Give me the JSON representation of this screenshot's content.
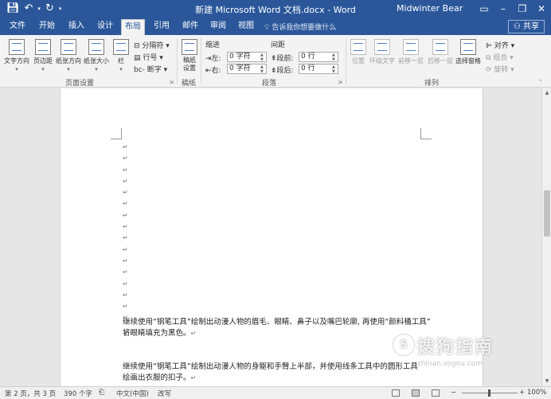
{
  "titlebar": {
    "title": "新建 Microsoft Word 文档.docx  -  Word",
    "user": "Midwinter Bear",
    "qat": {
      "save_icon": "save-icon",
      "undo_icon": "undo-icon",
      "redo_icon": "redo-icon"
    }
  },
  "tabs": [
    {
      "label": "文件"
    },
    {
      "label": "开始"
    },
    {
      "label": "插入"
    },
    {
      "label": "设计"
    },
    {
      "label": "布局"
    },
    {
      "label": "引用"
    },
    {
      "label": "邮件"
    },
    {
      "label": "审阅"
    },
    {
      "label": "视图"
    }
  ],
  "active_tab": "布局",
  "tell_me": "告诉我你想要做什么",
  "share": "共享",
  "ribbon": {
    "page_setup": {
      "label": "页面设置",
      "text_direction": "文字方向",
      "margins": "页边距",
      "orientation": "纸张方向",
      "size": "纸张大小",
      "columns": "栏",
      "breaks": "分隔符",
      "line_numbers": "行号",
      "hyphenation": "断字"
    },
    "draft": {
      "label": "稿纸",
      "button": "稿纸设置"
    },
    "paragraph": {
      "label": "段落",
      "indent": "缩进",
      "spacing": "间距",
      "left": "左:",
      "right": "右:",
      "before": "段前:",
      "after": "段后:",
      "left_value": "0 字符",
      "right_value": "0 字符",
      "before_value": "0 行",
      "after_value": "0 行"
    },
    "arrange": {
      "label": "排列",
      "position": "位置",
      "wrap_text": "环绕文字",
      "bring_forward": "前移一层",
      "send_backward": "后移一层",
      "selection_pane": "选择窗格",
      "align": "对齐",
      "group": "组合",
      "rotate": "旋转"
    }
  },
  "document": {
    "paragraph_mark": "↵",
    "empty_marks": [
      "↵",
      "↵",
      "↵",
      "↵",
      "↵",
      "↵",
      "↵",
      "↵",
      "↵",
      "↵",
      "↵",
      "↵",
      "↵",
      "↵",
      "↵",
      "↵"
    ],
    "line_arrow": "↓",
    "p1_line1": "继续使用“钢笔工具”绘制出动漫人物的眉毛、眼睛、鼻子以及嘴巴轮廓, 再使用“颜料桶工具”",
    "p1_line2": "将眼睛填充为黑色。",
    "p2_line1": "继续使用“钢笔工具”绘制出动漫人物的身躯和手臂上半部，并使用线条工具中的圆形工具",
    "p2_line2": "绘画出衣服的扣子。"
  },
  "statusbar": {
    "page": "第 2 页，共 3 页",
    "words": "390 个字",
    "language": "中文(中国)",
    "mode": "改写",
    "zoom": "100%",
    "zoom_minus": "−",
    "zoom_plus": "+"
  },
  "watermark": {
    "title": "搜狗指南",
    "url": "zhinan.sogou.com",
    "logo": "S"
  }
}
